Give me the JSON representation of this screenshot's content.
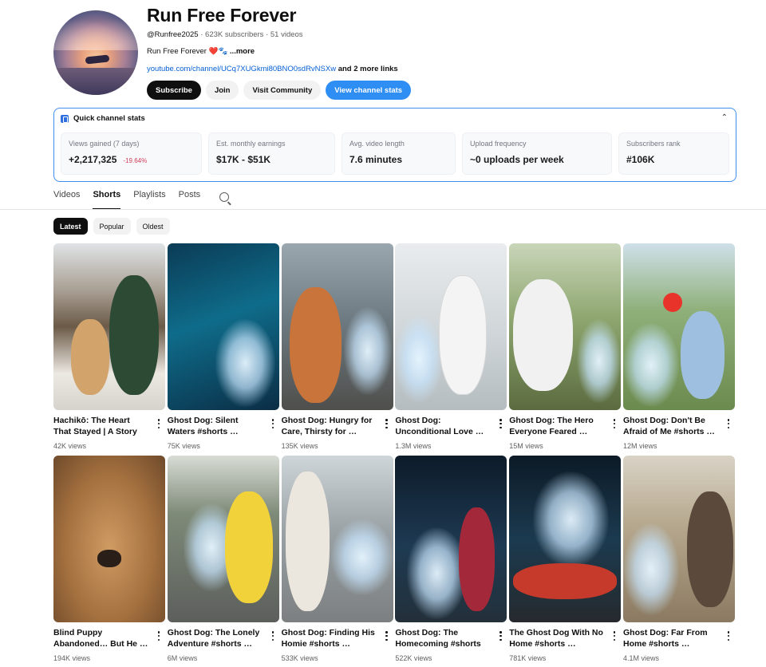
{
  "channel": {
    "name": "Run Free Forever",
    "handle": "@Runfree2025",
    "subscribers": "623K subscribers",
    "videos": "51 videos",
    "description": "Run Free Forever ❤️🐾",
    "more": "...more",
    "link": "youtube.com/channel/UCq7XUGkmi80BNO0sdRvNSXw",
    "extra_links": "and 2 more links"
  },
  "buttons": {
    "subscribe": "Subscribe",
    "join": "Join",
    "community": "Visit Community",
    "stats": "View channel stats"
  },
  "stats": {
    "title": "Quick channel stats",
    "items": [
      {
        "label": "Views gained (7 days)",
        "value": "+2,217,325",
        "delta": "-19.64%"
      },
      {
        "label": "Est. monthly earnings",
        "value": "$17K - $51K"
      },
      {
        "label": "Avg. video length",
        "value": "7.6 minutes"
      },
      {
        "label": "Upload frequency",
        "value": "~0 uploads per week"
      },
      {
        "label": "Subscribers rank",
        "value": "#106K"
      }
    ]
  },
  "tabs": [
    "Videos",
    "Shorts",
    "Playlists",
    "Posts"
  ],
  "chips": [
    "Latest",
    "Popular",
    "Oldest"
  ],
  "shorts": [
    {
      "title": "Hachikō: The Heart That Stayed | A Story Retol…",
      "views": "42K views"
    },
    {
      "title": "Ghost Dog: Silent Waters #shorts …",
      "views": "75K views"
    },
    {
      "title": "Ghost Dog: Hungry for Care, Thirsty for …",
      "views": "135K views"
    },
    {
      "title": "Ghost Dog: Unconditional Love …",
      "views": "1.3M views"
    },
    {
      "title": "Ghost Dog: The Hero Everyone Feared …",
      "views": "15M views"
    },
    {
      "title": "Ghost Dog: Don't Be Afraid of Me #shorts …",
      "views": "12M views"
    },
    {
      "title": "Blind Puppy Abandoned… But He …",
      "views": "194K views"
    },
    {
      "title": "Ghost Dog: The Lonely Adventure #shorts …",
      "views": "6M views"
    },
    {
      "title": "Ghost Dog: Finding His Homie #shorts …",
      "views": "533K views"
    },
    {
      "title": "Ghost Dog: The Homecoming #shorts …",
      "views": "522K views"
    },
    {
      "title": "The Ghost Dog With No Home #shorts …",
      "views": "781K views"
    },
    {
      "title": "Ghost Dog: Far From Home #shorts …",
      "views": "4.1M views"
    }
  ]
}
